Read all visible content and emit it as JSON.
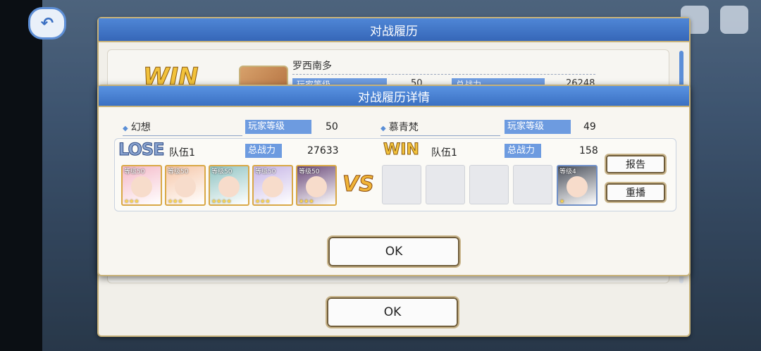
{
  "outer_dialog": {
    "title": "对战履历",
    "result": "WIN",
    "opponent_name": "罗西南多",
    "player_level_label": "玩家等级",
    "player_level_value": "50",
    "power_label": "总战力",
    "power_value": "26248",
    "ok_label": "OK"
  },
  "detail": {
    "title": "对战履历详情",
    "left": {
      "name": "幻想",
      "level_label": "玩家等级",
      "level": "50",
      "result": "LOSE",
      "team_label": "队伍1",
      "power_label": "总战力",
      "power": "27633",
      "characters": [
        {
          "level": "等级50",
          "stars": "★★★",
          "color": "#f4b9c8"
        },
        {
          "level": "等级50",
          "stars": "★★★",
          "color": "#f6c7a9"
        },
        {
          "level": "等级50",
          "stars": "★★★★",
          "color": "#8fc3c2"
        },
        {
          "level": "等级50",
          "stars": "★★★",
          "color": "#c6b5e6"
        },
        {
          "level": "等级50",
          "stars": "★★★",
          "color": "#6b4a7a"
        }
      ]
    },
    "vs": "VS",
    "right": {
      "name": "慕青梵",
      "level_label": "玩家等级",
      "level": "49",
      "result": "WIN",
      "team_label": "队伍1",
      "power_label": "总战力",
      "power": "158",
      "characters": [
        {
          "level": "等级4",
          "stars": "★",
          "color": "#4a4f5a"
        }
      ]
    },
    "report_label": "报告",
    "replay_label": "重播",
    "ok_label": "OK"
  },
  "colors": {
    "header_blue": "#3a70c2",
    "tag_blue": "#6d9be0",
    "gold": "#f2c23b"
  }
}
